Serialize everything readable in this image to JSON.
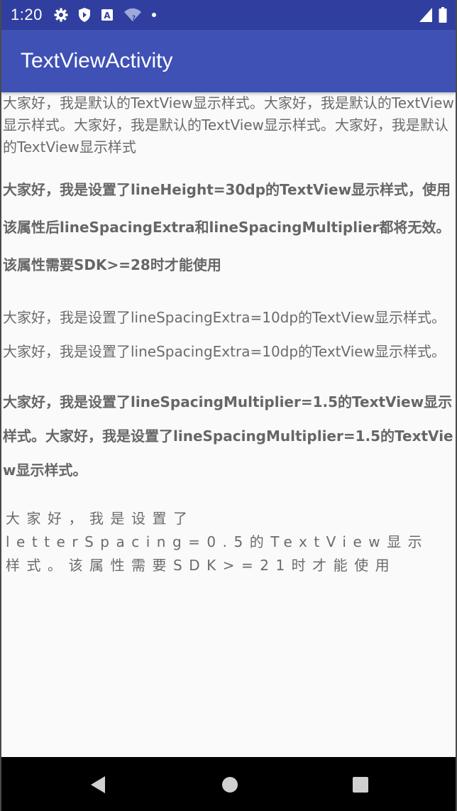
{
  "status_bar": {
    "time": "1:20",
    "icons": [
      "gear-icon",
      "shield-icon",
      "a-notification-icon",
      "wifi-unknown-icon",
      "dot-icon",
      "signal-icon",
      "battery-icon"
    ],
    "wifi_label": "?"
  },
  "app_bar": {
    "title": "TextViewActivity"
  },
  "text_views": {
    "default": "大家好，我是默认的TextView显示样式。大家好，我是默认的TextView显示样式。大家好，我是默认的TextView显示样式。大家好，我是默认的TextView显示样式",
    "line_height": "大家好，我是设置了lineHeight=30dp的TextView显示样式，使用该属性后lineSpacingExtra和lineSpacingMultiplier都将无效。该属性需要SDK>=28时才能使用",
    "line_spacing_extra": "大家好，我是设置了lineSpacingExtra=10dp的TextView显示样式。大家好，我是设置了lineSpacingExtra=10dp的TextView显示样式。",
    "line_spacing_multiplier": "大家好，我是设置了lineSpacingMultiplier=1.5的TextView显示样式。大家好，我是设置了lineSpacingMultiplier=1.5的TextView显示样式。",
    "letter_spacing_line1": "大家好，我是设置了",
    "letter_spacing_line2": "letterSpacing=0.5的TextView显示",
    "letter_spacing_line3": "样式。该属性需要SDK>=21时才能使用"
  },
  "nav_bar": {
    "icons": [
      "back-icon",
      "home-icon",
      "recents-icon"
    ]
  },
  "colors": {
    "status_bar": "#303f9f",
    "app_bar": "#3f51b5",
    "text": "#6b6b6b",
    "background": "#fafafa"
  }
}
